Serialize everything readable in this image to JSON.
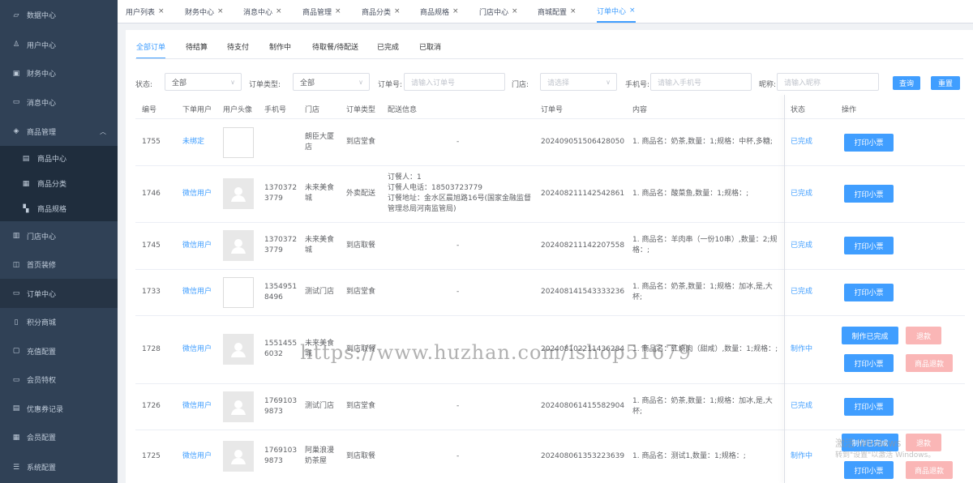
{
  "sidebar": {
    "items": [
      {
        "label": "数据中心",
        "icon": "chart-icon"
      },
      {
        "label": "用户中心",
        "icon": "user-icon"
      },
      {
        "label": "财务中心",
        "icon": "wallet-icon"
      },
      {
        "label": "消息中心",
        "icon": "message-icon"
      },
      {
        "label": "商品管理",
        "icon": "cube-icon",
        "arrow": "︿"
      },
      {
        "label": "商品中心",
        "icon": "list-icon"
      },
      {
        "label": "商品分类",
        "icon": "grid-icon"
      },
      {
        "label": "商品规格",
        "icon": "spec-icon"
      },
      {
        "label": "门店中心",
        "icon": "bars-icon"
      },
      {
        "label": "首页装修",
        "icon": "box-icon"
      },
      {
        "label": "订单中心",
        "icon": "inbox-icon"
      },
      {
        "label": "积分商城",
        "icon": "document-icon"
      },
      {
        "label": "充值配置",
        "icon": "recharge-icon"
      },
      {
        "label": "会员特权",
        "icon": "card-icon"
      },
      {
        "label": "优惠券记录",
        "icon": "coupon-icon"
      },
      {
        "label": "会员配置",
        "icon": "settings-list-icon"
      },
      {
        "label": "系统配置",
        "icon": "menu-icon"
      }
    ]
  },
  "tabs": [
    "用户列表",
    "财务中心",
    "消息中心",
    "商品管理",
    "商品分类",
    "商品规格",
    "门店中心",
    "商城配置",
    "订单中心"
  ],
  "status_tabs": [
    "全部订单",
    "待结算",
    "待支付",
    "制作中",
    "待取餐/待配送",
    "已完成",
    "已取消"
  ],
  "filters": {
    "status_label": "状态:",
    "status_value": "全部",
    "type_label": "订单类型:",
    "type_value": "全部",
    "order_label": "订单号:",
    "order_placeholder": "请输入订单号",
    "store_label": "门店:",
    "store_placeholder": "请选择",
    "phone_label": "手机号:",
    "phone_placeholder": "请输入手机号",
    "nick_label": "昵称:",
    "nick_placeholder": "请输入昵称",
    "query_btn": "查询",
    "reset_btn": "重置"
  },
  "columns": [
    "编号",
    "下单用户",
    "用户头像",
    "手机号",
    "门店",
    "订单类型",
    "配送信息",
    "订单号",
    "内容",
    "状态",
    "操作"
  ],
  "rows": [
    {
      "id": "1755",
      "user": "未绑定",
      "avatar": "broken",
      "phone": [
        "",
        ""
      ],
      "store": [
        "朗臣大厦",
        "店"
      ],
      "type": "到店堂食",
      "delivery": [
        "-"
      ],
      "order_no": "202409051506428050",
      "content": [
        "1. 商品名：奶茶,数量：1;规格：中杯,多糖;"
      ],
      "status": "已完成",
      "actions": [
        "打印小票"
      ]
    },
    {
      "id": "1746",
      "user": "微信用户",
      "avatar": "default",
      "phone": [
        "1370372",
        "3779"
      ],
      "store": [
        "未来美食",
        "城"
      ],
      "type": "外卖配送",
      "delivery": [
        "订餐人：1",
        "订餐人电话：18503723779",
        "订餐地址：金水区晨旭路16号(国家金融监督",
        "管理总局河南监管局)"
      ],
      "order_no": "202408211142542861",
      "content": [
        "1. 商品名：酸菜鱼,数量：1;规格：;"
      ],
      "status": "已完成",
      "actions": [
        "打印小票"
      ]
    },
    {
      "id": "1745",
      "user": "微信用户",
      "avatar": "default",
      "phone": [
        "1370372",
        "3779"
      ],
      "store": [
        "未来美食",
        "城"
      ],
      "type": "到店取餐",
      "delivery": [
        "-"
      ],
      "order_no": "202408211142207558",
      "content": [
        "1. 商品名：羊肉串（一份10串）,数量：2;规",
        "格：;"
      ],
      "status": "已完成",
      "actions": [
        "打印小票"
      ]
    },
    {
      "id": "1733",
      "user": "微信用户",
      "avatar": "broken",
      "phone": [
        "1354951",
        "8496"
      ],
      "store": [
        "测试门店",
        ""
      ],
      "type": "到店堂食",
      "delivery": [
        "-"
      ],
      "order_no": "202408141543333236",
      "content": [
        "1. 商品名：奶茶,数量：1;规格：加冰,是,大",
        "杯;"
      ],
      "status": "已完成",
      "actions": [
        "打印小票"
      ]
    },
    {
      "id": "1728",
      "user": "微信用户",
      "avatar": "default",
      "phone": [
        "1551455",
        "6032"
      ],
      "store": [
        "未来美食",
        "城"
      ],
      "type": "到店取餐",
      "delivery": [
        "-"
      ],
      "order_no": "202408102211436284",
      "content": [
        "1. 商品名：红烧肉（甜咸）,数量：1;规格：;"
      ],
      "status": "制作中",
      "actions": [
        "制作已完成",
        "退款",
        "打印小票",
        "商品退款"
      ]
    },
    {
      "id": "1726",
      "user": "微信用户",
      "avatar": "default",
      "phone": [
        "1769103",
        "9873"
      ],
      "store": [
        "测试门店",
        ""
      ],
      "type": "到店堂食",
      "delivery": [
        "-"
      ],
      "order_no": "202408061415582904",
      "content": [
        "1. 商品名：奶茶,数量：1;规格：加冰,是,大",
        "杯;"
      ],
      "status": "已完成",
      "actions": [
        "打印小票"
      ]
    },
    {
      "id": "1725",
      "user": "微信用户",
      "avatar": "default",
      "phone": [
        "1769103",
        "9873"
      ],
      "store": [
        "阿巢浪漫",
        "奶茶屋"
      ],
      "type": "到店取餐",
      "delivery": [
        "-"
      ],
      "order_no": "202408061353223639",
      "content": [
        "1. 商品名：测试1,数量：1;规格：;"
      ],
      "status": "制作中",
      "actions": [
        "制作已完成",
        "退款",
        "打印小票",
        "商品退款"
      ]
    }
  ],
  "watermark": "https://www.huzhan.com/ishop51679",
  "activation": {
    "line1": "激活 Windows",
    "line2": "转到\"设置\"以激活 Windows。"
  },
  "colors": {
    "sidebar": "#304156",
    "primary": "#409eff",
    "danger_light": "#fab6b6"
  }
}
